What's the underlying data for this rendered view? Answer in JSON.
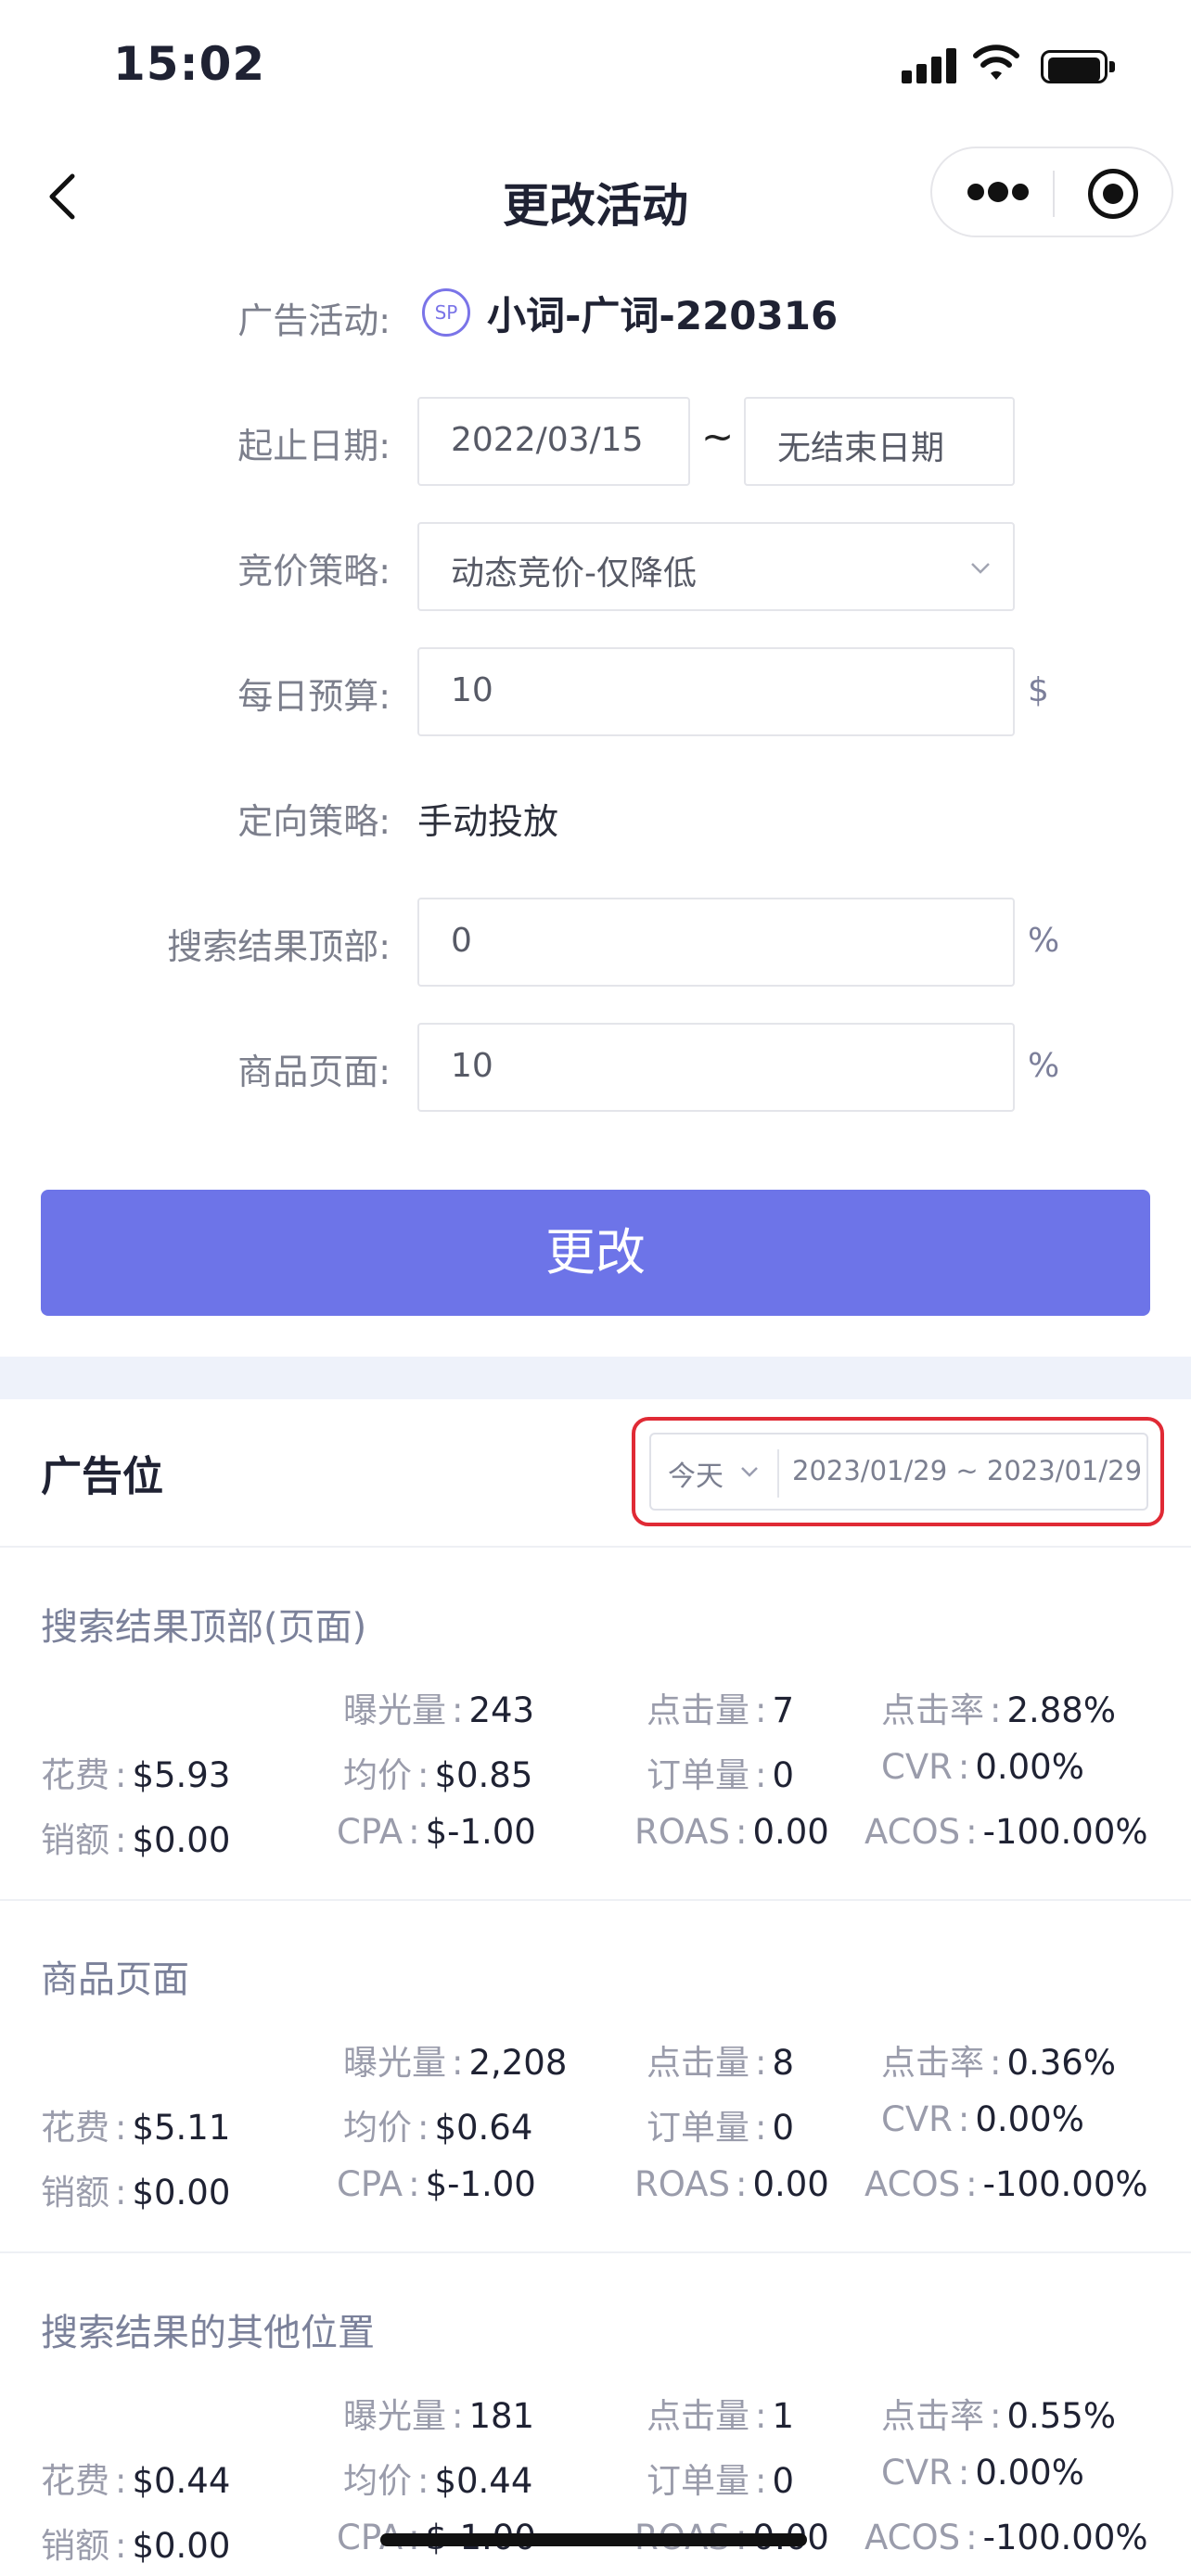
{
  "status_bar": {
    "time": "15:02"
  },
  "nav": {
    "title": "更改活动"
  },
  "form": {
    "campaign": {
      "label": "广告活动:",
      "badge": "SP",
      "name": "小词-广词-220316"
    },
    "dates": {
      "label": "起止日期:",
      "start": "2022/03/15",
      "separator": "~",
      "end": "无结束日期"
    },
    "bid_strategy": {
      "label": "竞价策略:",
      "value": "动态竞价-仅降低"
    },
    "daily_budget": {
      "label": "每日预算:",
      "value": "10",
      "unit": "$"
    },
    "targeting": {
      "label": "定向策略:",
      "value": "手动投放"
    },
    "top_of_search": {
      "label": "搜索结果顶部:",
      "value": "0",
      "unit": "%"
    },
    "product_page": {
      "label": "商品页面:",
      "value": "10",
      "unit": "%"
    },
    "submit_label": "更改"
  },
  "placement": {
    "title": "广告位",
    "range": {
      "preset": "今天",
      "dates": "2023/01/29 ~ 2023/01/29"
    },
    "colon": ":",
    "cards": [
      {
        "title": "搜索结果顶部(页面)",
        "impressions": {
          "label": "曝光量",
          "value": "243"
        },
        "clicks": {
          "label": "点击量",
          "value": "7"
        },
        "ctr": {
          "label": "点击率",
          "value": "2.88%"
        },
        "spend": {
          "label": "花费",
          "value": "$5.93"
        },
        "cpc": {
          "label": "均价",
          "value": "$0.85"
        },
        "orders": {
          "label": "订单量",
          "value": "0"
        },
        "cvr": {
          "label": "CVR",
          "value": "0.00%"
        },
        "sales": {
          "label": "销额",
          "value": "$0.00"
        },
        "cpa": {
          "label": "CPA",
          "value": "$-1.00"
        },
        "roas": {
          "label": "ROAS",
          "value": "0.00"
        },
        "acos": {
          "label": "ACOS",
          "value": "-100.00%"
        }
      },
      {
        "title": "商品页面",
        "impressions": {
          "label": "曝光量",
          "value": "2,208"
        },
        "clicks": {
          "label": "点击量",
          "value": "8"
        },
        "ctr": {
          "label": "点击率",
          "value": "0.36%"
        },
        "spend": {
          "label": "花费",
          "value": "$5.11"
        },
        "cpc": {
          "label": "均价",
          "value": "$0.64"
        },
        "orders": {
          "label": "订单量",
          "value": "0"
        },
        "cvr": {
          "label": "CVR",
          "value": "0.00%"
        },
        "sales": {
          "label": "销额",
          "value": "$0.00"
        },
        "cpa": {
          "label": "CPA",
          "value": "$-1.00"
        },
        "roas": {
          "label": "ROAS",
          "value": "0.00"
        },
        "acos": {
          "label": "ACOS",
          "value": "-100.00%"
        }
      },
      {
        "title": "搜索结果的其他位置",
        "impressions": {
          "label": "曝光量",
          "value": "181"
        },
        "clicks": {
          "label": "点击量",
          "value": "1"
        },
        "ctr": {
          "label": "点击率",
          "value": "0.55%"
        },
        "spend": {
          "label": "花费",
          "value": "$0.44"
        },
        "cpc": {
          "label": "均价",
          "value": "$0.44"
        },
        "orders": {
          "label": "订单量",
          "value": "0"
        },
        "cvr": {
          "label": "CVR",
          "value": "0.00%"
        },
        "sales": {
          "label": "销额",
          "value": "$0.00"
        },
        "cpa": {
          "label": "CPA",
          "value": "$-1.00"
        },
        "roas": {
          "label": "ROAS",
          "value": "0.00"
        },
        "acos": {
          "label": "ACOS",
          "value": "-100.00%"
        }
      }
    ]
  }
}
